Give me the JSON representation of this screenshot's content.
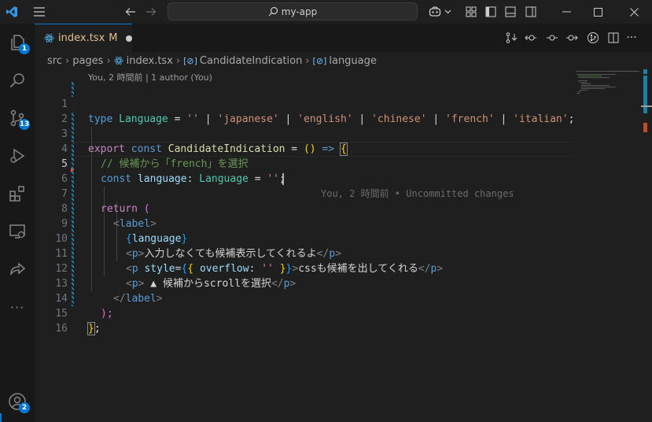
{
  "titlebar": {
    "search_text": "my-app",
    "icons": [
      "vscode-logo-icon",
      "menu-icon",
      "back-arrow-icon",
      "forward-arrow-icon",
      "search-icon",
      "copilot-icon",
      "chevron-down-icon",
      "customize-layout-icon",
      "toggle-sidebar-icon",
      "toggle-panel-icon",
      "toggle-secondary-sidebar-icon",
      "minimize-icon",
      "maximize-icon",
      "close-icon"
    ]
  },
  "activitybar": {
    "items": [
      {
        "name": "explorer",
        "badge": "1"
      },
      {
        "name": "search",
        "badge": ""
      },
      {
        "name": "source-control",
        "badge": "13"
      },
      {
        "name": "run-debug",
        "badge": ""
      },
      {
        "name": "extensions",
        "badge": ""
      },
      {
        "name": "remote-explorer",
        "badge": ""
      },
      {
        "name": "live-share",
        "badge": ""
      },
      {
        "name": "more",
        "badge": ""
      }
    ],
    "accounts_badge": "2",
    "more_label": "···"
  },
  "tab": {
    "filename": "index.tsx",
    "status": "M"
  },
  "breadcrumb": {
    "items": [
      "src",
      "pages",
      "index.tsx",
      "CandidateIndication",
      "language"
    ]
  },
  "editor": {
    "codelens": "You, 2 時間前 | 1 author (You)",
    "inline_blame": "You, 2 時間前 • Uncommitted changes",
    "line_numbers": [
      "1",
      "2",
      "3",
      "4",
      "5",
      "6",
      "7",
      "8",
      "9",
      "10",
      "11",
      "12",
      "13",
      "14",
      "15",
      "16"
    ],
    "current_line": "5",
    "tokens": {
      "l1_type": "type",
      "l1_name": "Language",
      "l1_eq": " = ",
      "l1_s0": "''",
      "l1_s1": "'japanese'",
      "l1_s2": "'english'",
      "l1_s3": "'chinese'",
      "l1_s4": "'french'",
      "l1_s5": "'italian'",
      "pipe": " | ",
      "semi": ";",
      "l3_export": "export",
      "l3_const": "const",
      "l3_name": "CandidateIndication",
      "l3_eq": " = ",
      "l3_parens": "()",
      "l3_arrow": " => ",
      "l3_brace": "{",
      "l4_comment": "// 候補から「french」を選択",
      "l5_const": "const",
      "l5_var": "language",
      "l5_colon": ": ",
      "l5_type": "Language",
      "l5_eq": " = ",
      "l5_str": "''",
      "l7_return": "return",
      "l7_paren": " (",
      "l8_open": "<",
      "l8_tag": "label",
      "l8_close": ">",
      "l9_b1": "{",
      "l9_var": "language",
      "l9_b2": "}",
      "p_tag": "p",
      "l10_text": "入力しなくても候補表示してくれるよ",
      "l11_attr": "style",
      "l11_eq": "=",
      "l11_b1": "{",
      "l11_b2": "{",
      "l11_prop": "overflow",
      "l11_colon": ": ",
      "l11_val": "''",
      "l11_b3": "}",
      "l11_b4": "}",
      "l11_text": "cssも候補を出してくれる",
      "l12_text": " ▲ 候補からscrollを選択",
      "l13_close_tag": "label",
      "l14_close": ");",
      "l15_close": "}",
      "l15_semi": ";"
    }
  }
}
